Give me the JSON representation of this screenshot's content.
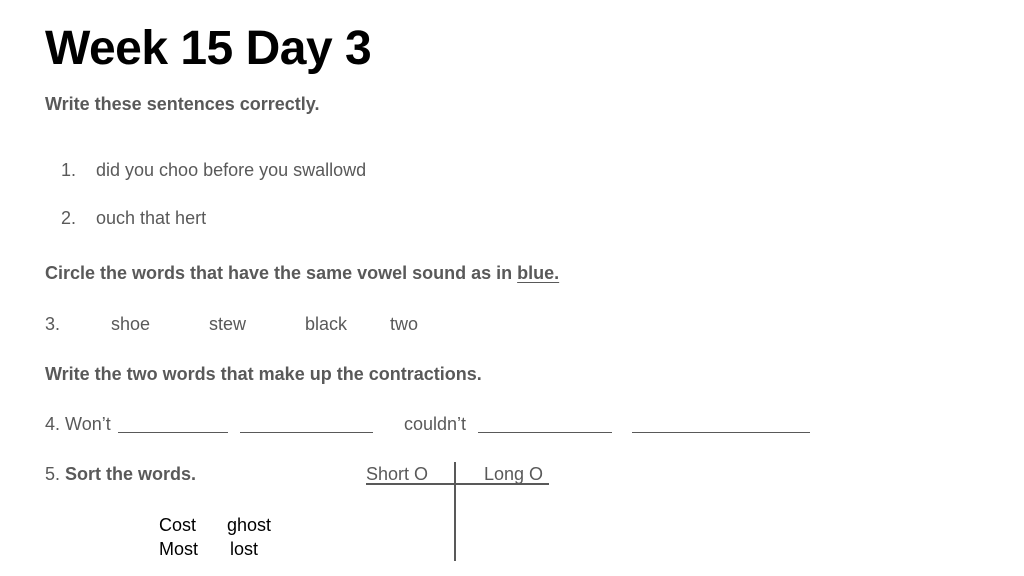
{
  "worksheet": {
    "title": "Week 15 Day 3",
    "section1": {
      "heading": "Write these sentences correctly.",
      "items": [
        {
          "number": "1.",
          "text": "did you choo before you swallowd"
        },
        {
          "number": "2.",
          "text": "ouch that hert"
        }
      ]
    },
    "section2": {
      "heading_prefix": "Circle the words that have the same vowel sound as in ",
      "heading_keyword": "blue.",
      "item_number": "3.",
      "words": [
        "shoe",
        "stew",
        "black",
        "two"
      ]
    },
    "section3": {
      "heading": "Write the two words that make up the contractions.",
      "item_number": "4.",
      "contractions": [
        "Won’t",
        "couldn’t"
      ]
    },
    "section4": {
      "item_number": "5.",
      "heading": "Sort the words.",
      "columns": [
        "Short O",
        "Long O"
      ],
      "word_bank": [
        [
          "Cost",
          "ghost"
        ],
        [
          "Most",
          "lost"
        ]
      ]
    }
  }
}
